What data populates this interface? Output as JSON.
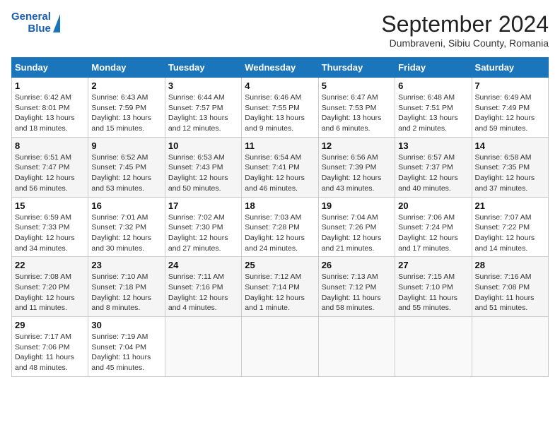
{
  "header": {
    "logo_line1": "General",
    "logo_line2": "Blue",
    "month_title": "September 2024",
    "location": "Dumbraveni, Sibiu County, Romania"
  },
  "weekdays": [
    "Sunday",
    "Monday",
    "Tuesday",
    "Wednesday",
    "Thursday",
    "Friday",
    "Saturday"
  ],
  "weeks": [
    [
      {
        "day": "1",
        "info": "Sunrise: 6:42 AM\nSunset: 8:01 PM\nDaylight: 13 hours\nand 18 minutes."
      },
      {
        "day": "2",
        "info": "Sunrise: 6:43 AM\nSunset: 7:59 PM\nDaylight: 13 hours\nand 15 minutes."
      },
      {
        "day": "3",
        "info": "Sunrise: 6:44 AM\nSunset: 7:57 PM\nDaylight: 13 hours\nand 12 minutes."
      },
      {
        "day": "4",
        "info": "Sunrise: 6:46 AM\nSunset: 7:55 PM\nDaylight: 13 hours\nand 9 minutes."
      },
      {
        "day": "5",
        "info": "Sunrise: 6:47 AM\nSunset: 7:53 PM\nDaylight: 13 hours\nand 6 minutes."
      },
      {
        "day": "6",
        "info": "Sunrise: 6:48 AM\nSunset: 7:51 PM\nDaylight: 13 hours\nand 2 minutes."
      },
      {
        "day": "7",
        "info": "Sunrise: 6:49 AM\nSunset: 7:49 PM\nDaylight: 12 hours\nand 59 minutes."
      }
    ],
    [
      {
        "day": "8",
        "info": "Sunrise: 6:51 AM\nSunset: 7:47 PM\nDaylight: 12 hours\nand 56 minutes."
      },
      {
        "day": "9",
        "info": "Sunrise: 6:52 AM\nSunset: 7:45 PM\nDaylight: 12 hours\nand 53 minutes."
      },
      {
        "day": "10",
        "info": "Sunrise: 6:53 AM\nSunset: 7:43 PM\nDaylight: 12 hours\nand 50 minutes."
      },
      {
        "day": "11",
        "info": "Sunrise: 6:54 AM\nSunset: 7:41 PM\nDaylight: 12 hours\nand 46 minutes."
      },
      {
        "day": "12",
        "info": "Sunrise: 6:56 AM\nSunset: 7:39 PM\nDaylight: 12 hours\nand 43 minutes."
      },
      {
        "day": "13",
        "info": "Sunrise: 6:57 AM\nSunset: 7:37 PM\nDaylight: 12 hours\nand 40 minutes."
      },
      {
        "day": "14",
        "info": "Sunrise: 6:58 AM\nSunset: 7:35 PM\nDaylight: 12 hours\nand 37 minutes."
      }
    ],
    [
      {
        "day": "15",
        "info": "Sunrise: 6:59 AM\nSunset: 7:33 PM\nDaylight: 12 hours\nand 34 minutes."
      },
      {
        "day": "16",
        "info": "Sunrise: 7:01 AM\nSunset: 7:32 PM\nDaylight: 12 hours\nand 30 minutes."
      },
      {
        "day": "17",
        "info": "Sunrise: 7:02 AM\nSunset: 7:30 PM\nDaylight: 12 hours\nand 27 minutes."
      },
      {
        "day": "18",
        "info": "Sunrise: 7:03 AM\nSunset: 7:28 PM\nDaylight: 12 hours\nand 24 minutes."
      },
      {
        "day": "19",
        "info": "Sunrise: 7:04 AM\nSunset: 7:26 PM\nDaylight: 12 hours\nand 21 minutes."
      },
      {
        "day": "20",
        "info": "Sunrise: 7:06 AM\nSunset: 7:24 PM\nDaylight: 12 hours\nand 17 minutes."
      },
      {
        "day": "21",
        "info": "Sunrise: 7:07 AM\nSunset: 7:22 PM\nDaylight: 12 hours\nand 14 minutes."
      }
    ],
    [
      {
        "day": "22",
        "info": "Sunrise: 7:08 AM\nSunset: 7:20 PM\nDaylight: 12 hours\nand 11 minutes."
      },
      {
        "day": "23",
        "info": "Sunrise: 7:10 AM\nSunset: 7:18 PM\nDaylight: 12 hours\nand 8 minutes."
      },
      {
        "day": "24",
        "info": "Sunrise: 7:11 AM\nSunset: 7:16 PM\nDaylight: 12 hours\nand 4 minutes."
      },
      {
        "day": "25",
        "info": "Sunrise: 7:12 AM\nSunset: 7:14 PM\nDaylight: 12 hours\nand 1 minute."
      },
      {
        "day": "26",
        "info": "Sunrise: 7:13 AM\nSunset: 7:12 PM\nDaylight: 11 hours\nand 58 minutes."
      },
      {
        "day": "27",
        "info": "Sunrise: 7:15 AM\nSunset: 7:10 PM\nDaylight: 11 hours\nand 55 minutes."
      },
      {
        "day": "28",
        "info": "Sunrise: 7:16 AM\nSunset: 7:08 PM\nDaylight: 11 hours\nand 51 minutes."
      }
    ],
    [
      {
        "day": "29",
        "info": "Sunrise: 7:17 AM\nSunset: 7:06 PM\nDaylight: 11 hours\nand 48 minutes."
      },
      {
        "day": "30",
        "info": "Sunrise: 7:19 AM\nSunset: 7:04 PM\nDaylight: 11 hours\nand 45 minutes."
      },
      {
        "day": "",
        "info": ""
      },
      {
        "day": "",
        "info": ""
      },
      {
        "day": "",
        "info": ""
      },
      {
        "day": "",
        "info": ""
      },
      {
        "day": "",
        "info": ""
      }
    ]
  ]
}
